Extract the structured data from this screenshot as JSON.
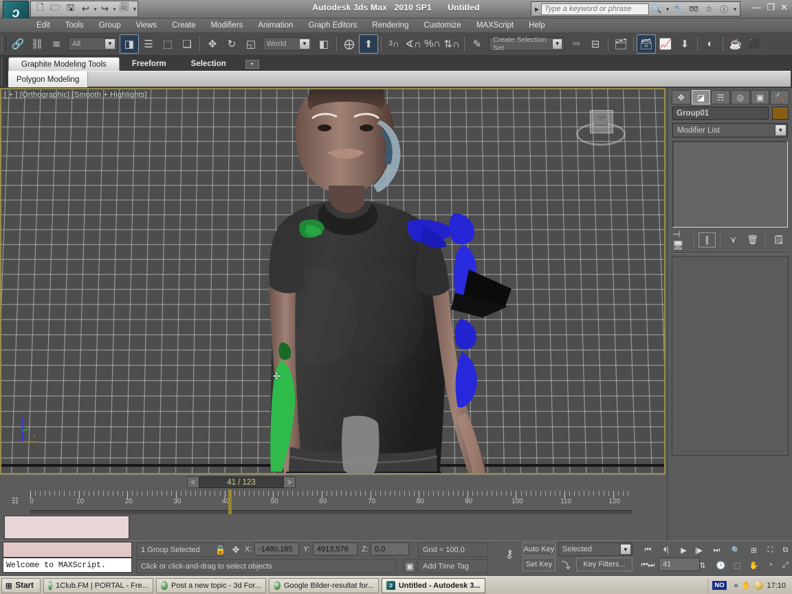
{
  "titlebar": {
    "logo": "max-logo",
    "app_name": "Autodesk 3ds Max",
    "version": "2010 SP1",
    "document": "Untitled",
    "quick_access": [
      {
        "name": "new-file-button",
        "glyph": "🗋"
      },
      {
        "name": "open-file-button",
        "glyph": "🗁"
      },
      {
        "name": "save-file-button",
        "glyph": "🖫"
      },
      {
        "name": "undo-button",
        "glyph": "↩"
      },
      {
        "name": "undo-dropdown",
        "glyph": "▾"
      },
      {
        "name": "redo-button",
        "glyph": "↪"
      },
      {
        "name": "redo-dropdown",
        "glyph": "▾"
      },
      {
        "name": "project-folder-button",
        "glyph": "🗐"
      },
      {
        "name": "qat-overflow-button",
        "glyph": "▼"
      }
    ],
    "search_placeholder": "Type a keyword or phrase",
    "search_value": "",
    "search_icons": [
      {
        "name": "find-icon",
        "glyph": "🕮"
      },
      {
        "name": "search-dropdown-icon",
        "glyph": "▾"
      },
      {
        "name": "key-icon",
        "glyph": "🔧"
      },
      {
        "name": "satellite-icon",
        "glyph": "📡"
      },
      {
        "name": "favorites-star-icon",
        "glyph": "☆"
      },
      {
        "name": "help-icon",
        "glyph": "?"
      },
      {
        "name": "help-dropdown-icon",
        "glyph": "▾"
      }
    ],
    "window_buttons": [
      {
        "name": "minimize-button",
        "glyph": "—"
      },
      {
        "name": "restore-button",
        "glyph": "❐"
      },
      {
        "name": "close-button",
        "glyph": "✕"
      }
    ]
  },
  "menubar": {
    "items": [
      "Edit",
      "Tools",
      "Group",
      "Views",
      "Create",
      "Modifiers",
      "Animation",
      "Graph Editors",
      "Rendering",
      "Customize",
      "MAXScript",
      "Help"
    ]
  },
  "main_toolbar": {
    "selection_filter": "All",
    "reference_coord_system": "World",
    "named_selection_sets": "Create Selection Set",
    "snap_count": "3",
    "buttons": [
      {
        "name": "select-and-link-button",
        "glyph": "🔗"
      },
      {
        "name": "unlink-selection-button",
        "glyph": "⛓"
      },
      {
        "name": "bind-to-space-warp-button",
        "glyph": "≋"
      },
      {
        "name": "select-object-button",
        "glyph": "◩",
        "active": true
      },
      {
        "name": "select-by-name-button",
        "glyph": "⫴"
      },
      {
        "name": "rectangular-selection-region-button",
        "glyph": "▭"
      },
      {
        "name": "window-crossing-button",
        "glyph": "⬚"
      },
      {
        "name": "select-and-move-button",
        "glyph": "✥"
      },
      {
        "name": "select-and-rotate-button",
        "glyph": "↻"
      },
      {
        "name": "select-and-scale-button",
        "glyph": "⬗"
      },
      {
        "name": "use-center-flyout-button",
        "glyph": "▣"
      },
      {
        "name": "select-and-manipulate-button",
        "glyph": "⊹"
      },
      {
        "name": "keyboard-shortcut-override-button",
        "glyph": "⬆",
        "active": true
      },
      {
        "name": "snaps-toggle-button",
        "glyph": "⌒"
      },
      {
        "name": "angle-snap-toggle-button",
        "glyph": "∡"
      },
      {
        "name": "percent-snap-toggle-button",
        "glyph": "%"
      },
      {
        "name": "spinner-snap-toggle-button",
        "glyph": "⇕"
      },
      {
        "name": "edit-named-selection-sets-button",
        "glyph": "✎"
      },
      {
        "name": "mirror-button",
        "glyph": "◫"
      },
      {
        "name": "align-button",
        "glyph": "⊟"
      },
      {
        "name": "layer-manager-button",
        "glyph": "▤"
      },
      {
        "name": "toggle-ribbon-button",
        "glyph": "🗀",
        "active": true
      },
      {
        "name": "curve-editor-button",
        "glyph": "📈"
      },
      {
        "name": "schematic-view-button",
        "glyph": "⇩"
      },
      {
        "name": "material-editor-button",
        "glyph": "◉"
      },
      {
        "name": "render-setup-button",
        "glyph": "🫖"
      }
    ]
  },
  "ribbon": {
    "tabs": [
      {
        "label": "Graphite Modeling Tools",
        "active": true
      },
      {
        "label": "Freeform",
        "active": false
      },
      {
        "label": "Selection",
        "active": false
      }
    ],
    "overflow_glyph": "▾",
    "panel_tab": "Polygon Modeling"
  },
  "viewport": {
    "label": "[ + ] [Orthographic] [Smooth + Highlights]",
    "viewcube": {
      "top_label": "TOP",
      "front_label": "FRONT"
    },
    "cursor_glyph": "✛",
    "axis_tripod_label": "x"
  },
  "command_panel": {
    "tabs": [
      {
        "name": "create-tab",
        "glyph": "✥",
        "active": false
      },
      {
        "name": "modify-tab",
        "glyph": "◪",
        "active": true
      },
      {
        "name": "hierarchy-tab",
        "glyph": "品",
        "active": false
      },
      {
        "name": "motion-tab",
        "glyph": "◎",
        "active": false
      },
      {
        "name": "display-tab",
        "glyph": "▣",
        "active": false
      },
      {
        "name": "utilities-tab",
        "glyph": "🔨",
        "active": false
      }
    ],
    "object_name": "Group01",
    "object_color": "#8a5d17",
    "modifier_list_label": "Modifier List",
    "stack_buttons": [
      {
        "name": "pin-stack-button",
        "glyph": "⊣"
      },
      {
        "name": "show-end-result-button",
        "glyph": "⑊",
        "boxed": true
      },
      {
        "name": "make-unique-button",
        "glyph": "⋎"
      },
      {
        "name": "remove-modifier-button",
        "glyph": "🗑"
      },
      {
        "name": "configure-modifier-sets-button",
        "glyph": "▦"
      }
    ]
  },
  "timeline": {
    "prev_frame_glyph": "<",
    "next_frame_glyph": ">",
    "frame_display": "41 / 123",
    "current_frame": 41,
    "total_frames": 123,
    "ruler_labels": [
      "0",
      "10",
      "20",
      "30",
      "40",
      "50",
      "60",
      "70",
      "80",
      "90",
      "100",
      "110",
      "120"
    ],
    "track_icon": "⎌"
  },
  "statusbar": {
    "maxscript_listener_text": "Welcome to MAXScript.",
    "selection_status": "1 Group Selected",
    "lock_icon": "🔒",
    "coord_icon": "✥",
    "coords": [
      {
        "label": "X:",
        "value": "-1480,185"
      },
      {
        "label": "Y:",
        "value": "4913,576"
      },
      {
        "label": "Z:",
        "value": "0,0"
      }
    ],
    "grid_text": "Grid = 100,0",
    "prompt_text": "Click or click-and-drag to select objects",
    "add_time_tag": "Add Time Tag",
    "isolate_icon": "▣",
    "key_mode_icon": "⚷",
    "auto_key_label": "Auto Key",
    "set_key_label": "Set Key",
    "key_filters_label": "Key Filters...",
    "key_mode_dropdown": "Selected",
    "frame_field": "41",
    "playback_buttons": [
      {
        "name": "goto-start-button",
        "glyph": "⏮"
      },
      {
        "name": "previous-frame-button",
        "glyph": "◀|"
      },
      {
        "name": "play-animation-button",
        "glyph": "▶"
      },
      {
        "name": "next-frame-button",
        "glyph": "|▶"
      },
      {
        "name": "goto-end-button",
        "glyph": "⏭"
      }
    ],
    "nav_buttons": [
      {
        "name": "zoom-button",
        "glyph": "🔍"
      },
      {
        "name": "zoom-all-button",
        "glyph": "⊞"
      },
      {
        "name": "zoom-extents-button",
        "glyph": "⛶"
      },
      {
        "name": "zoom-region-button",
        "glyph": "⧉"
      },
      {
        "name": "time-configuration-button",
        "glyph": "🕓"
      },
      {
        "name": "field-of-view-button",
        "glyph": "⬚"
      },
      {
        "name": "pan-view-button",
        "glyph": "✋"
      },
      {
        "name": "orbit-button",
        "glyph": "◔"
      },
      {
        "name": "maximize-viewport-toggle-button",
        "glyph": "⤢"
      }
    ]
  },
  "taskbar": {
    "start_label": "Start",
    "tasks": [
      {
        "label": "1Club.FM | PORTAL - Fre...",
        "active": false
      },
      {
        "label": "Post a new topic - 3d For...",
        "active": false
      },
      {
        "label": "Google Bilder-resultat for...",
        "active": false
      },
      {
        "label": "Untitled - Autodesk 3...",
        "active": true
      }
    ],
    "tray_badge": "NO",
    "tray_chevron": "«",
    "clock": "17:10"
  }
}
